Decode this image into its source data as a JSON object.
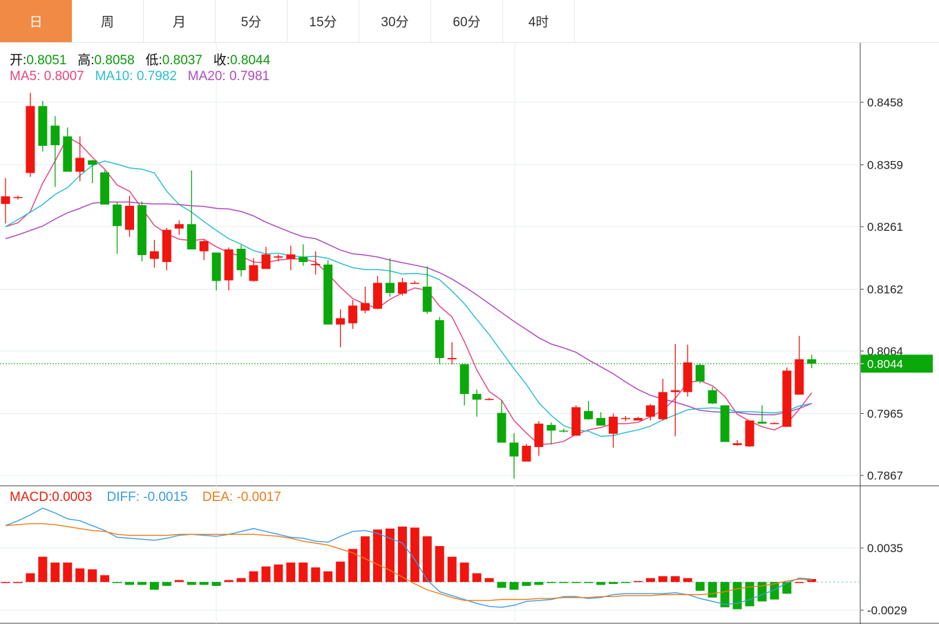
{
  "tabs": [
    {
      "label": "日",
      "active": true
    },
    {
      "label": "周",
      "active": false
    },
    {
      "label": "月",
      "active": false
    },
    {
      "label": "5分",
      "active": false
    },
    {
      "label": "15分",
      "active": false
    },
    {
      "label": "30分",
      "active": false
    },
    {
      "label": "60分",
      "active": false
    },
    {
      "label": "4时",
      "active": false
    }
  ],
  "ohlc_info": {
    "open_label": "开:",
    "open": "0.8051",
    "high_label": "高:",
    "high": "0.8058",
    "low_label": "低:",
    "low": "0.8037",
    "close_label": "收:",
    "close": "0.8044"
  },
  "ma_info": {
    "ma5_label": "MA5:",
    "ma5": "0.8007",
    "ma10_label": "MA10:",
    "ma10": "0.7982",
    "ma20_label": "MA20:",
    "ma20": "0.7981"
  },
  "macd_info": {
    "macd_label": "MACD:",
    "macd": "0.0003",
    "diff_label": "DIFF:",
    "diff": "-0.0015",
    "dea_label": "DEA:",
    "dea": "-0.0017"
  },
  "colors": {
    "up": "#f0150e",
    "down": "#0aa80a",
    "ma5": "#e8467c",
    "ma10": "#2bbfd0",
    "ma20": "#b04ac0",
    "diff": "#3a9de0",
    "dea": "#f07a1a",
    "last_price_bg": "#0aa80a"
  },
  "chart_data": [
    {
      "type": "candlestick",
      "title": "",
      "y_ticks": [
        "0.8458",
        "0.8359",
        "0.8261",
        "0.8162",
        "0.8064",
        "0.7965",
        "0.7867"
      ],
      "ylim": [
        0.7857,
        0.8517
      ],
      "last_price": "0.8044",
      "grid": true,
      "candles": [
        [
          0.8297,
          0.8309,
          0.8338,
          0.8266
        ],
        [
          0.8307,
          0.8308,
          0.831,
          0.8304
        ],
        [
          0.8346,
          0.8452,
          0.8473,
          0.834
        ],
        [
          0.8452,
          0.8389,
          0.846,
          0.838
        ],
        [
          0.8421,
          0.839,
          0.8436,
          0.8324
        ],
        [
          0.8404,
          0.8348,
          0.8418,
          0.8348
        ],
        [
          0.8348,
          0.837,
          0.8404,
          0.8333
        ],
        [
          0.8366,
          0.8359,
          0.8367,
          0.833
        ],
        [
          0.8347,
          0.8296,
          0.835,
          0.8296
        ],
        [
          0.8296,
          0.8262,
          0.83,
          0.8218
        ],
        [
          0.8256,
          0.8294,
          0.831,
          0.8245
        ],
        [
          0.8295,
          0.8216,
          0.8301,
          0.8206
        ],
        [
          0.821,
          0.8222,
          0.824,
          0.8196
        ],
        [
          0.8205,
          0.8256,
          0.8259,
          0.8192
        ],
        [
          0.8258,
          0.8265,
          0.8271,
          0.8248
        ],
        [
          0.8265,
          0.8225,
          0.835,
          0.8225
        ],
        [
          0.8222,
          0.8238,
          0.824,
          0.8208
        ],
        [
          0.822,
          0.8175,
          0.822,
          0.816
        ],
        [
          0.8176,
          0.8225,
          0.8228,
          0.816
        ],
        [
          0.8226,
          0.8192,
          0.8232,
          0.8182
        ],
        [
          0.8175,
          0.82,
          0.8211,
          0.8174
        ],
        [
          0.8194,
          0.8217,
          0.8229,
          0.82
        ],
        [
          0.8212,
          0.8214,
          0.8217,
          0.8206
        ],
        [
          0.821,
          0.8217,
          0.8231,
          0.8192
        ],
        [
          0.8213,
          0.8205,
          0.8233,
          0.8199
        ],
        [
          0.82,
          0.8202,
          0.8222,
          0.8185
        ],
        [
          0.8201,
          0.8106,
          0.8208,
          0.8106
        ],
        [
          0.8106,
          0.8116,
          0.813,
          0.807
        ],
        [
          0.8108,
          0.8136,
          0.8145,
          0.8099
        ],
        [
          0.8128,
          0.814,
          0.8166,
          0.8124
        ],
        [
          0.8131,
          0.8172,
          0.8183,
          0.813
        ],
        [
          0.8172,
          0.8156,
          0.8211,
          0.815
        ],
        [
          0.8155,
          0.8173,
          0.818,
          0.8152
        ],
        [
          0.8171,
          0.8172,
          0.8175,
          0.8171
        ],
        [
          0.8166,
          0.8126,
          0.8198,
          0.8123
        ],
        [
          0.8113,
          0.8053,
          0.8118,
          0.8043
        ],
        [
          0.8051,
          0.8053,
          0.8078,
          0.8043
        ],
        [
          0.8043,
          0.7996,
          0.8043,
          0.7978
        ],
        [
          0.7996,
          0.7987,
          0.8003,
          0.796
        ],
        [
          0.7988,
          0.7988,
          0.799,
          0.7986
        ],
        [
          0.7966,
          0.7919,
          0.7986,
          0.7919
        ],
        [
          0.7919,
          0.7897,
          0.7934,
          0.7862
        ],
        [
          0.7889,
          0.7914,
          0.7917,
          0.7898
        ],
        [
          0.7912,
          0.7949,
          0.7953,
          0.7898
        ],
        [
          0.7947,
          0.7938,
          0.7951,
          0.7916
        ],
        [
          0.7938,
          0.7937,
          0.7941,
          0.7935
        ],
        [
          0.793,
          0.7975,
          0.7978,
          0.793
        ],
        [
          0.7969,
          0.7956,
          0.7985,
          0.7955
        ],
        [
          0.7958,
          0.7946,
          0.7967,
          0.7946
        ],
        [
          0.7933,
          0.796,
          0.7965,
          0.7911
        ],
        [
          0.7957,
          0.7958,
          0.7961,
          0.7953
        ],
        [
          0.7954,
          0.7958,
          0.796,
          0.7955
        ],
        [
          0.796,
          0.7978,
          0.798,
          0.7954
        ],
        [
          0.7956,
          0.7999,
          0.802,
          0.7954
        ],
        [
          0.7999,
          0.8002,
          0.8075,
          0.7929
        ],
        [
          0.7999,
          0.8046,
          0.8074,
          0.7992
        ],
        [
          0.8042,
          0.8016,
          0.8044,
          0.8013
        ],
        [
          0.8002,
          0.7981,
          0.8007,
          0.798
        ],
        [
          0.7978,
          0.792,
          0.7978,
          0.792
        ],
        [
          0.7915,
          0.7918,
          0.7923,
          0.7914
        ],
        [
          0.7913,
          0.7954,
          0.7954,
          0.7912
        ],
        [
          0.7952,
          0.7949,
          0.7978,
          0.7949
        ],
        [
          0.795,
          0.795,
          0.7951,
          0.7949
        ],
        [
          0.7944,
          0.8033,
          0.8038,
          0.7944
        ],
        [
          0.7995,
          0.8051,
          0.8088,
          0.7995
        ],
        [
          0.8051,
          0.8044,
          0.8058,
          0.8037
        ]
      ],
      "series": [
        {
          "name": "MA5",
          "values": [
            0.8261,
            0.8267,
            0.8285,
            0.833,
            0.8365,
            0.8403,
            0.8392,
            0.8371,
            0.8352,
            0.8327,
            0.8317,
            0.829,
            0.8263,
            0.825,
            0.8241,
            0.8239,
            0.8241,
            0.8229,
            0.822,
            0.8214,
            0.8205,
            0.8204,
            0.8208,
            0.821,
            0.821,
            0.8205,
            0.8186,
            0.8165,
            0.8147,
            0.8138,
            0.8132,
            0.8146,
            0.8156,
            0.8164,
            0.816,
            0.8135,
            0.8118,
            0.8079,
            0.8034,
            0.8,
            0.7986,
            0.7954,
            0.7934,
            0.7916,
            0.7917,
            0.7921,
            0.7932,
            0.7939,
            0.7943,
            0.7949,
            0.7949,
            0.7951,
            0.796,
            0.797,
            0.7989,
            0.8014,
            0.8017,
            0.8009,
            0.7992,
            0.7964,
            0.7953,
            0.7944,
            0.7939,
            0.7949,
            0.7972,
            0.7998
          ]
        },
        {
          "name": "MA10",
          "values": [
            0.8261,
            0.8272,
            0.8284,
            0.8296,
            0.8312,
            0.8323,
            0.8342,
            0.8358,
            0.8365,
            0.836,
            0.8354,
            0.8352,
            0.8346,
            0.8317,
            0.8296,
            0.8284,
            0.8269,
            0.8255,
            0.8242,
            0.8233,
            0.8223,
            0.8218,
            0.8219,
            0.8215,
            0.8213,
            0.8214,
            0.8211,
            0.8203,
            0.8196,
            0.8193,
            0.8193,
            0.8191,
            0.8186,
            0.8187,
            0.8185,
            0.8177,
            0.8159,
            0.8139,
            0.8114,
            0.809,
            0.8063,
            0.8036,
            0.8011,
            0.7982,
            0.7962,
            0.7946,
            0.7939,
            0.7937,
            0.7929,
            0.793,
            0.7935,
            0.7939,
            0.7945,
            0.7955,
            0.7963,
            0.7971,
            0.7973,
            0.7974,
            0.7973,
            0.7968,
            0.7968,
            0.7967,
            0.7966,
            0.7969,
            0.7977,
            0.7981
          ]
        },
        {
          "name": "MA20",
          "values": [
            0.8242,
            0.8248,
            0.8255,
            0.8262,
            0.8273,
            0.8283,
            0.829,
            0.8298,
            0.83,
            0.83,
            0.83,
            0.8298,
            0.8297,
            0.8297,
            0.8296,
            0.8294,
            0.8293,
            0.829,
            0.8289,
            0.8285,
            0.8278,
            0.8268,
            0.826,
            0.8252,
            0.8245,
            0.8242,
            0.8233,
            0.8224,
            0.8218,
            0.8216,
            0.8213,
            0.8208,
            0.8204,
            0.82,
            0.8196,
            0.8188,
            0.8178,
            0.8166,
            0.8153,
            0.8139,
            0.8125,
            0.8111,
            0.8098,
            0.8085,
            0.8075,
            0.8069,
            0.8062,
            0.805,
            0.8039,
            0.8028,
            0.8015,
            0.8003,
            0.7994,
            0.7988,
            0.7983,
            0.7977,
            0.797,
            0.7968,
            0.7967,
            0.7967,
            0.7964,
            0.7963,
            0.7963,
            0.7967,
            0.7973,
            0.7981
          ]
        }
      ]
    },
    {
      "type": "macd",
      "title": "",
      "y_ticks": [
        "0.0035",
        "-0.0029"
      ],
      "ylim": [
        -0.0034,
        0.0071
      ],
      "zero_line": 0,
      "grid": true,
      "histogram": [
        0,
        0,
        0.0009,
        0.0026,
        0.002,
        0.002,
        0.0014,
        0.0013,
        0.0007,
        -0.0001,
        -0.0003,
        -0.0003,
        -0.0008,
        -0.0004,
        0.0002,
        -0.0003,
        -0.0003,
        -0.0004,
        0.0002,
        0.0004,
        0.0011,
        0.0016,
        0.0018,
        0.002,
        0.002,
        0.0015,
        0.0011,
        0.0021,
        0.0034,
        0.0047,
        0.0054,
        0.0055,
        0.0057,
        0.0056,
        0.0047,
        0.0037,
        0.0026,
        0.002,
        0.0009,
        0.0004,
        -0.0006,
        -0.0008,
        -0.0004,
        -0.0003,
        -0.0001,
        -0.0001,
        -0.0001,
        -0.0001,
        -0.0003,
        -0.0002,
        -0.0001,
        0.0001,
        0.0004,
        0.0006,
        0.0006,
        0.0004,
        -0.0009,
        -0.0016,
        -0.0026,
        -0.0028,
        -0.0025,
        -0.002,
        -0.0018,
        -0.0012,
        0,
        0.0003
      ],
      "series": [
        {
          "name": "DIFF",
          "values": [
            0.0058,
            0.0063,
            0.0069,
            0.0076,
            0.0071,
            0.0065,
            0.0063,
            0.0058,
            0.0053,
            0.0046,
            0.0045,
            0.0044,
            0.0043,
            0.0045,
            0.0048,
            0.0049,
            0.0048,
            0.0047,
            0.0049,
            0.0052,
            0.0055,
            0.0052,
            0.0049,
            0.0046,
            0.0045,
            0.0042,
            0.0041,
            0.0047,
            0.0052,
            0.0053,
            0.005,
            0.0045,
            0.004,
            0.0023,
            0.0002,
            -0.001,
            -0.0014,
            -0.0018,
            -0.0022,
            -0.0025,
            -0.0026,
            -0.0024,
            -0.002,
            -0.0019,
            -0.0018,
            -0.0015,
            -0.0015,
            -0.0017,
            -0.0016,
            -0.0013,
            -0.0012,
            -0.0012,
            -0.0012,
            -0.0012,
            -0.0011,
            -0.0013,
            -0.0017,
            -0.002,
            -0.0023,
            -0.0022,
            -0.0018,
            -0.0013,
            -0.0008,
            -0.0001,
            0.0004,
            0.0003
          ]
        },
        {
          "name": "DEA",
          "values": [
            0.0058,
            0.0059,
            0.006,
            0.006,
            0.0059,
            0.0057,
            0.0055,
            0.0053,
            0.0052,
            0.0049,
            0.0048,
            0.0048,
            0.0048,
            0.0048,
            0.0049,
            0.0049,
            0.0049,
            0.0049,
            0.0049,
            0.0049,
            0.0049,
            0.0048,
            0.0047,
            0.0045,
            0.0042,
            0.004,
            0.0038,
            0.0034,
            0.003,
            0.0024,
            0.0018,
            0.0012,
            0.0005,
            -0.0002,
            -0.0008,
            -0.0012,
            -0.0016,
            -0.0019,
            -0.0019,
            -0.0019,
            -0.0018,
            -0.0018,
            -0.0018,
            -0.0017,
            -0.0017,
            -0.0016,
            -0.0016,
            -0.0016,
            -0.0015,
            -0.0015,
            -0.0014,
            -0.0014,
            -0.0014,
            -0.0013,
            -0.0013,
            -0.0013,
            -0.0013,
            -0.0012,
            -0.001,
            -0.0007,
            -0.0005,
            -0.0004,
            -0.0002,
            0.0001,
            0.0003,
            0.0002
          ]
        }
      ]
    }
  ]
}
